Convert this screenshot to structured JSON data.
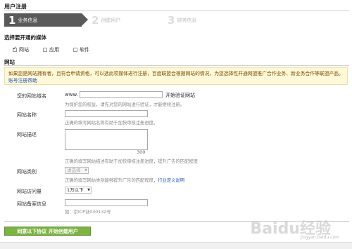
{
  "page": {
    "title": "用户注册"
  },
  "steps": [
    {
      "num": "1",
      "label": "业务信息",
      "active": true
    },
    {
      "num": "2",
      "label": "创建用户",
      "active": false
    },
    {
      "num": "3",
      "label": "财务信息",
      "active": false
    }
  ],
  "media": {
    "heading": "选择要开通的媒体",
    "options": [
      {
        "label": "网站",
        "checked": true
      },
      {
        "label": "应用",
        "checked": false
      },
      {
        "label": "软件",
        "checked": false
      }
    ]
  },
  "website_section": {
    "heading": "网站"
  },
  "notice": {
    "text": "如果您是网站拥有者，且符合申请资格，可以选此项媒体进行注册，百度联盟会根据网站的情况，为您选择性开通网盟推广合作业务、新业务合作等联盟产品。",
    "link": "账号注册帮助"
  },
  "form": {
    "domain": {
      "label": "您的网站域名",
      "prefix": "www.",
      "verify_button": "开始验证网站",
      "hint": "为保护您的权益，请先对您的网站进行验证，才能继续注册。"
    },
    "name": {
      "label": "网站名称",
      "hint": "正确的填写网站名称有助于加快审核注册进度。"
    },
    "desc": {
      "label": "网站描述",
      "counter": "300",
      "hint": "正确的填写网站描述有助于加快审核注册进度，提升广告的匹配程度"
    },
    "category": {
      "label": "网站类别",
      "selected": "请选择",
      "hint": "正确的填写网站类别能够提升广告的匹配程度，",
      "link": "行业定义说明"
    },
    "traffic": {
      "label": "网站访问量",
      "selected": "1万以下"
    },
    "icp": {
      "label": "网站备案信息",
      "hint": "如：京ICP证030132号"
    }
  },
  "submit": {
    "label": "同意以下协议 开始创建用户"
  },
  "watermark": {
    "brand": "Baidu经验",
    "sub": "jingyan.baidu.com"
  },
  "colors": {
    "accent_green": "#7cb342",
    "link_blue": "#1e56b5",
    "notice_bg": "#fff8d9",
    "step_active": "#5a5a5a"
  }
}
